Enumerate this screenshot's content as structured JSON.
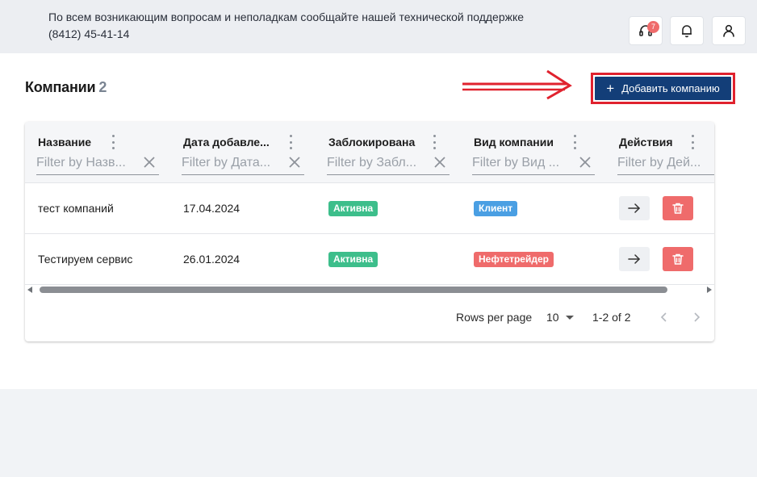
{
  "header": {
    "support_line1": "По всем возникающим вопросам и неполадкам сообщайте нашей технической поддержке",
    "support_line2": "(8412) 45-41-14",
    "support_badge": "7"
  },
  "page": {
    "title": "Компании",
    "count": "2",
    "add_button_label": "Добавить компанию"
  },
  "grid": {
    "columns": [
      {
        "title": "Название",
        "filter_placeholder": "Filter by Назв..."
      },
      {
        "title": "Дата добавле...",
        "filter_placeholder": "Filter by Дата..."
      },
      {
        "title": "Заблокирована",
        "filter_placeholder": "Filter by Забл..."
      },
      {
        "title": "Вид компании",
        "filter_placeholder": "Filter by Вид ..."
      },
      {
        "title": "Действия",
        "filter_placeholder": "Filter by Дей..."
      }
    ],
    "rows": [
      {
        "name": "тест компаний",
        "date": "17.04.2024",
        "status": "Активна",
        "type": "Клиент"
      },
      {
        "name": "Тестируем сервис",
        "date": "26.01.2024",
        "status": "Активна",
        "type": "Нефтетрейдер"
      }
    ],
    "footer": {
      "rows_per_page_label": "Rows per page",
      "rows_per_page_value": "10",
      "range": "1-2 of 2"
    }
  },
  "colors": {
    "accent": "#133e78",
    "highlight": "#e0222e",
    "status_active": "#3dbe8b",
    "type_client": "#4a9fe3",
    "type_trader": "#ef6b6b",
    "delete": "#ef6b6b"
  }
}
